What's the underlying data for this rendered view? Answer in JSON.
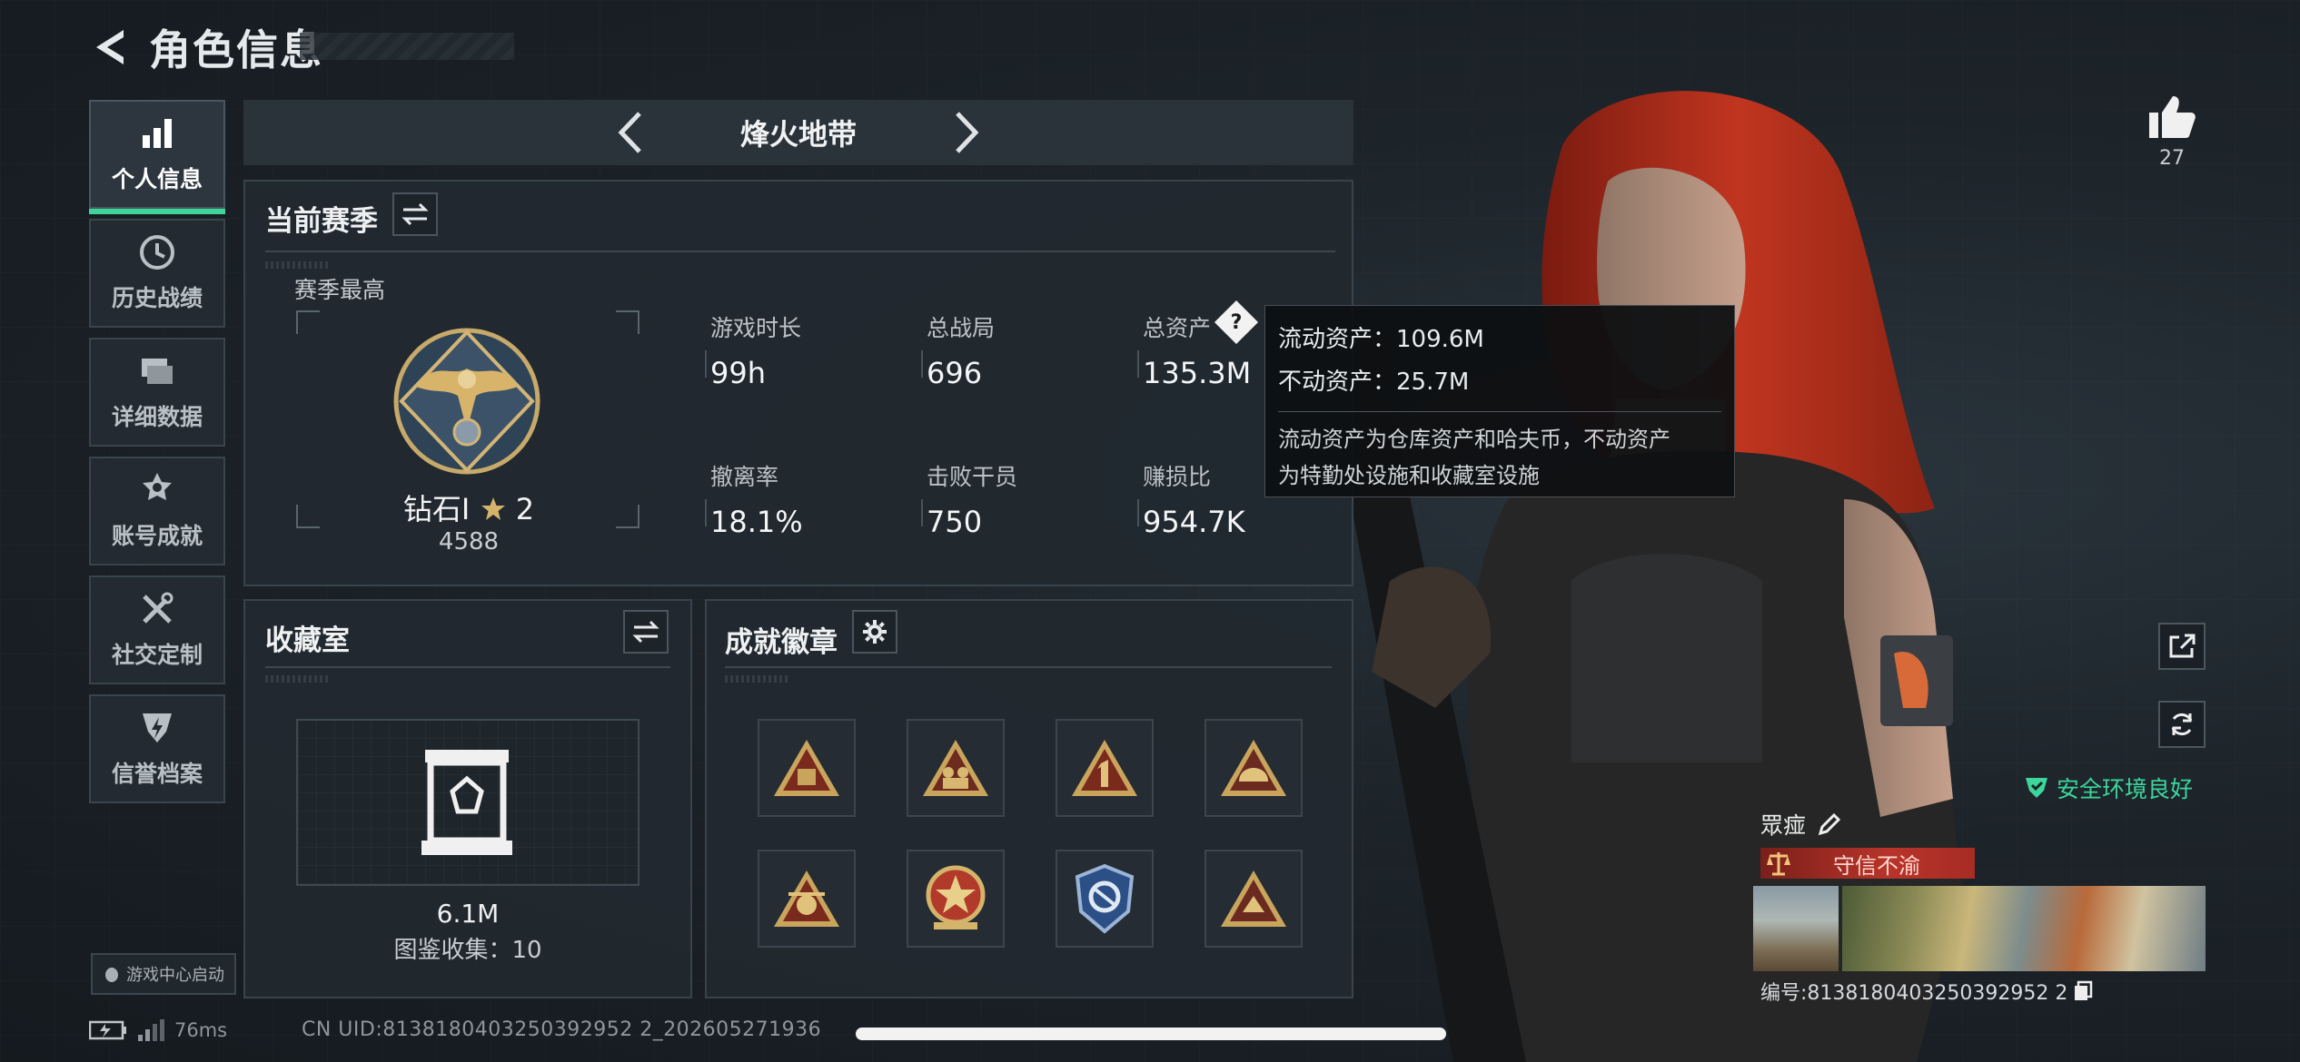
{
  "header": {
    "title": "角色信息"
  },
  "nav": {
    "items": [
      {
        "label": "个人信息",
        "icon": "bar-chart-icon",
        "active": true
      },
      {
        "label": "历史战绩",
        "icon": "clock-icon"
      },
      {
        "label": "详细数据",
        "icon": "folders-icon"
      },
      {
        "label": "账号成就",
        "icon": "medal-icon"
      },
      {
        "label": "社交定制",
        "icon": "tools-icon"
      },
      {
        "label": "信誉档案",
        "icon": "shield-bolt-icon"
      }
    ],
    "launch_label": "游戏中心启动"
  },
  "mode": {
    "name": "烽火地带"
  },
  "season": {
    "title": "当前赛季",
    "best_label": "赛季最高",
    "rank_name": "钻石I",
    "rank_stars": "2",
    "rank_score": "4588",
    "stats": [
      {
        "label": "游戏时长",
        "value": "99h"
      },
      {
        "label": "总战局",
        "value": "696"
      },
      {
        "label": "总资产",
        "value": "135.3M"
      },
      {
        "label": "撤离率",
        "value": "18.1%"
      },
      {
        "label": "击败干员",
        "value": "750"
      },
      {
        "label": "赚损比",
        "value": "954.7K"
      }
    ]
  },
  "tooltip": {
    "liquid": "流动资产：109.6M",
    "fixed": "不动资产：25.7M",
    "note_line1": "流动资产为仓库资产和哈夫币，不动资产",
    "note_line2": "为特勤处设施和收藏室设施"
  },
  "collection": {
    "title": "收藏室",
    "value": "6.1M",
    "count": "图鉴收集：10"
  },
  "achievements": {
    "title": "成就徽章",
    "badge_count": 8
  },
  "like": {
    "count": "27"
  },
  "profile": {
    "safe_text": "安全环境良好",
    "name": "眾痖",
    "reputation": "守信不渝",
    "uid": "编号:8138180403250392952 2"
  },
  "status": {
    "ping": "76ms",
    "cn_uid": "CN UID:8138180403250392952 2_202605271936"
  },
  "colors": {
    "accent": "#3dd59b",
    "panel": "#222930",
    "border": "#39434b",
    "reputation": "#b8342a"
  }
}
